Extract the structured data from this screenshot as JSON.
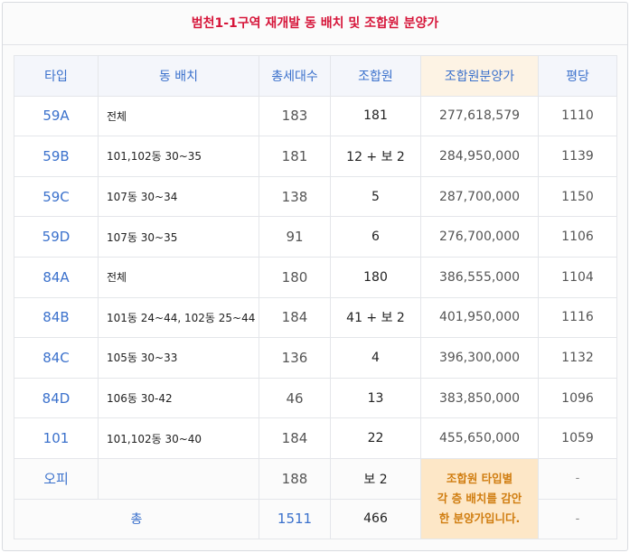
{
  "title": "범천1-1구역 재개발 동 배치 및 조합원 분양가",
  "headers": {
    "type": "타입",
    "location": "동 배치",
    "units": "총세대수",
    "members": "조합원",
    "price": "조합원분양가",
    "per_pyeong": "평당"
  },
  "rows": [
    {
      "type": "59A",
      "location": "전체",
      "units": "183",
      "members": "181",
      "price": "277,618,579",
      "per_pyeong": "1110"
    },
    {
      "type": "59B",
      "location": "101,102동 30~35",
      "units": "181",
      "members": "12 + 보 2",
      "price": "284,950,000",
      "per_pyeong": "1139"
    },
    {
      "type": "59C",
      "location": "107동 30~34",
      "units": "138",
      "members": "5",
      "price": "287,700,000",
      "per_pyeong": "1150"
    },
    {
      "type": "59D",
      "location": "107동 30~35",
      "units": "91",
      "members": "6",
      "price": "276,700,000",
      "per_pyeong": "1106"
    },
    {
      "type": "84A",
      "location": "전체",
      "units": "180",
      "members": "180",
      "price": "386,555,000",
      "per_pyeong": "1104"
    },
    {
      "type": "84B",
      "location": "101동 24~44, 102동 25~44",
      "units": "184",
      "members": "41 + 보 2",
      "price": "401,950,000",
      "per_pyeong": "1116"
    },
    {
      "type": "84C",
      "location": "105동 30~33",
      "units": "136",
      "members": "4",
      "price": "396,300,000",
      "per_pyeong": "1132"
    },
    {
      "type": "84D",
      "location": "106동 30-42",
      "units": "46",
      "members": "13",
      "price": "383,850,000",
      "per_pyeong": "1096"
    },
    {
      "type": "101",
      "location": "101,102동 30~40",
      "units": "184",
      "members": "22",
      "price": "455,650,000",
      "per_pyeong": "1059"
    }
  ],
  "officetel": {
    "type": "오피",
    "location": "",
    "units": "188",
    "members": "보 2",
    "per_pyeong": "-"
  },
  "total": {
    "label": "총",
    "units": "1511",
    "members": "466",
    "per_pyeong": "-"
  },
  "note": {
    "line1": "조합원 타입별",
    "line2": "각 층 배치를 감안",
    "line3": "한 분양가입니다."
  }
}
